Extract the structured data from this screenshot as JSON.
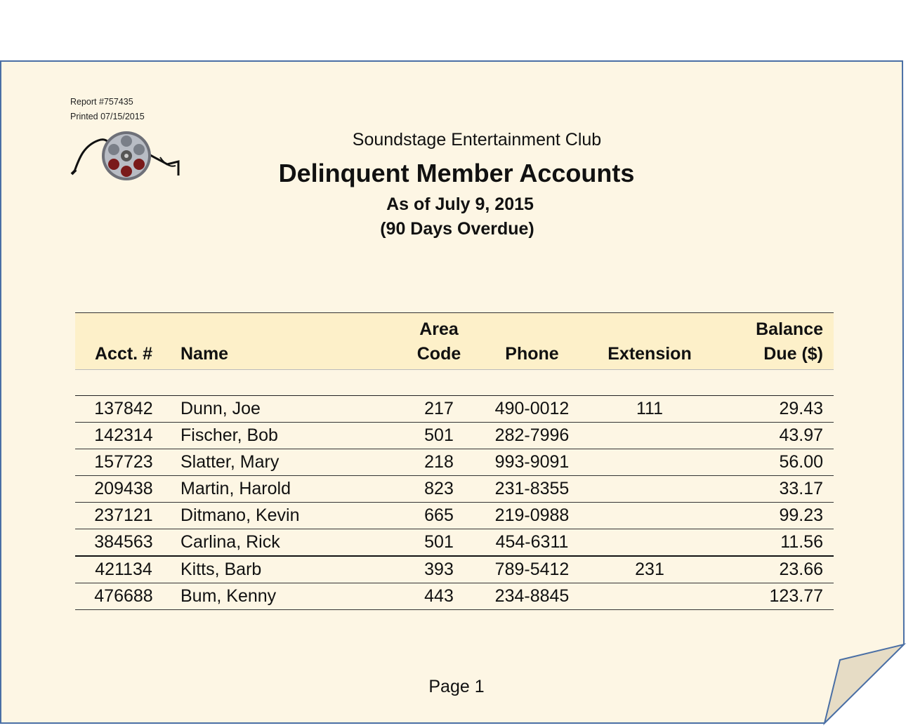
{
  "report": {
    "report_number": "Report #757435",
    "printed": "Printed 07/15/2015"
  },
  "header": {
    "club_name": "Soundstage Entertainment Club",
    "title": "Delinquent Member Accounts",
    "as_of": "As of July 9, 2015",
    "subtitle": "(90 Days Overdue)"
  },
  "logo": {
    "icon": "film-reel-icon"
  },
  "colors": {
    "paper": "#fdf6e4",
    "paper_border": "#4a6fa5",
    "header_fill": "#fdf0c9",
    "page_curl": "#e6dcc5"
  },
  "table": {
    "columns": [
      {
        "line1": "",
        "line2": "Acct. #"
      },
      {
        "line1": "",
        "line2": "Name"
      },
      {
        "line1": "Area",
        "line2": "Code"
      },
      {
        "line1": "",
        "line2": "Phone"
      },
      {
        "line1": "",
        "line2": "Extension"
      },
      {
        "line1": "Balance",
        "line2": "Due ($)"
      }
    ],
    "rows": [
      {
        "acct": "137842",
        "name": "Dunn, Joe",
        "area": "217",
        "phone": "490-0012",
        "ext": "111",
        "balance": "29.43"
      },
      {
        "acct": "142314",
        "name": "Fischer, Bob",
        "area": "501",
        "phone": "282-7996",
        "ext": "",
        "balance": "43.97"
      },
      {
        "acct": "157723",
        "name": "Slatter, Mary",
        "area": "218",
        "phone": "993-9091",
        "ext": "",
        "balance": "56.00"
      },
      {
        "acct": "209438",
        "name": "Martin, Harold",
        "area": "823",
        "phone": "231-8355",
        "ext": "",
        "balance": "33.17"
      },
      {
        "acct": "237121",
        "name": "Ditmano, Kevin",
        "area": "665",
        "phone": "219-0988",
        "ext": "",
        "balance": "99.23"
      },
      {
        "acct": "384563",
        "name": "Carlina, Rick",
        "area": "501",
        "phone": "454-6311",
        "ext": "",
        "balance": "11.56"
      },
      {
        "acct": "421134",
        "name": "Kitts, Barb",
        "area": "393",
        "phone": "789-5412",
        "ext": "231",
        "balance": "23.66"
      },
      {
        "acct": "476688",
        "name": "Bum, Kenny",
        "area": "443",
        "phone": "234-8845",
        "ext": "",
        "balance": "123.77"
      }
    ]
  },
  "footer": {
    "page": "Page 1"
  }
}
